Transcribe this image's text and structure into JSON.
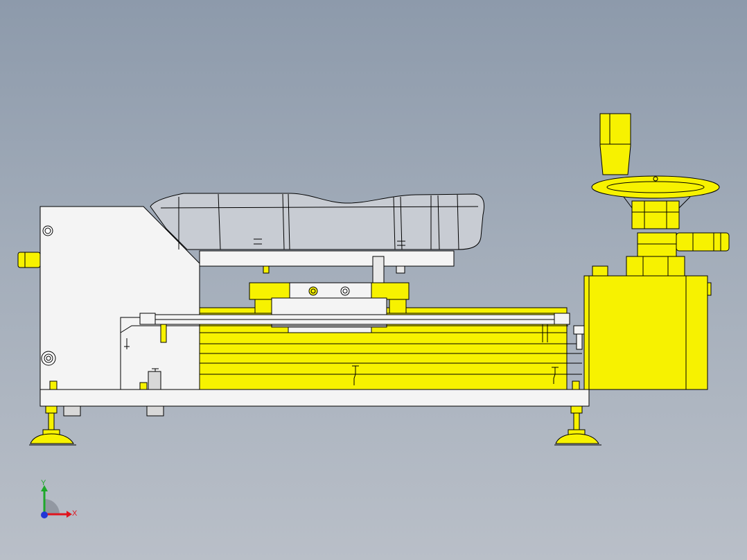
{
  "triad": {
    "x_label": "X",
    "y_label": "Y",
    "x_color": "#e0141e",
    "y_color": "#1ea82a",
    "z_color": "#2236d6"
  },
  "colors": {
    "background_top": "#8d9aab",
    "background_bottom": "#b9bfc8",
    "part_yellow": "#f7f200",
    "part_white": "#f4f4f4",
    "part_grey": "#c8ccd3",
    "edge": "#000000"
  },
  "parts": [
    "left-housing",
    "base-plate",
    "leveling-foot-left",
    "leveling-foot-right",
    "linear-rail-body",
    "carriage-block",
    "cushion-pad",
    "top-plate",
    "gearbox-housing",
    "handwheel",
    "handwheel-grip",
    "locking-lever"
  ]
}
